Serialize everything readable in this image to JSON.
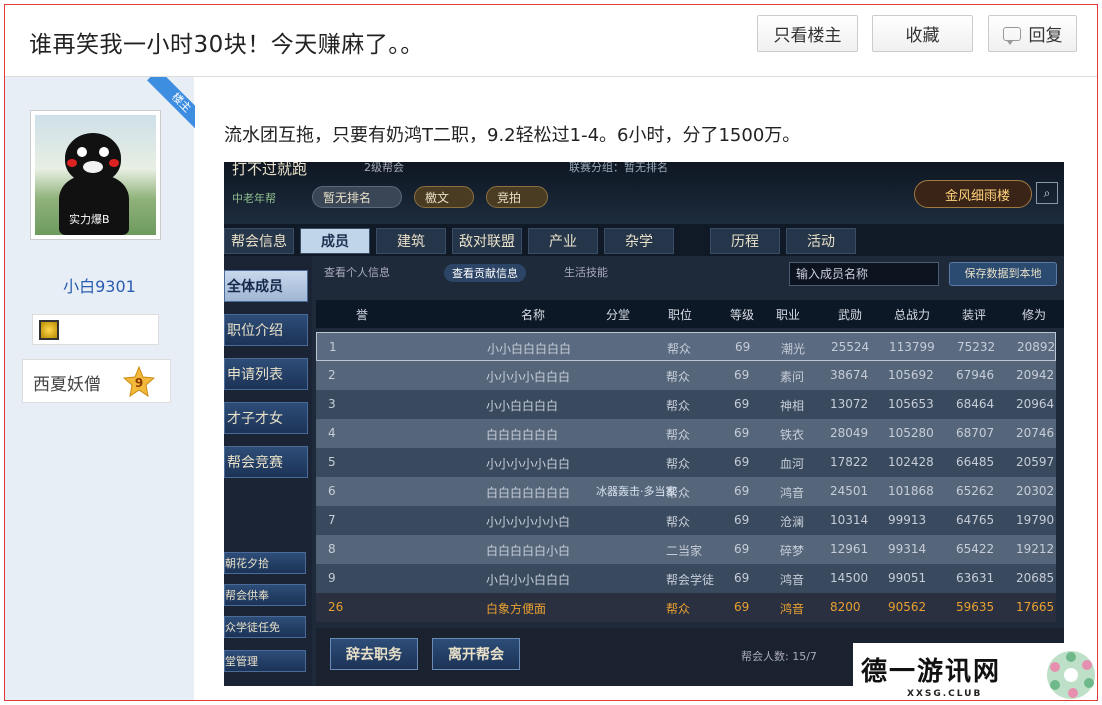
{
  "header": {
    "title": "谁再笑我一小时30块！今天赚麻了。。",
    "btn_owner_only": "只看楼主",
    "btn_favorite": "收藏",
    "btn_reply": "回复"
  },
  "author": {
    "badge": "楼主",
    "avatar_caption": "实力爆B",
    "username": "小白9301",
    "rank_title": "西夏妖僧",
    "rank_level": "9"
  },
  "post": {
    "text": "流水团互拖，只要有奶鸿T二职，9.2轻松过1-4。6小时，分了1500万。"
  },
  "game": {
    "top_title": "打不过就跑",
    "top_sub": "2级帮会",
    "top_note": "联赛分组：暂无排名",
    "top_left": "中老年帮",
    "pill_rank": "暂无排名",
    "pill_edict": "檄文",
    "pill_auction": "竞拍",
    "guild_name": "金风细雨楼",
    "tabs": [
      "帮会信息",
      "成员",
      "建筑",
      "敌对联盟",
      "产业",
      "杂学",
      "历程",
      "活动"
    ],
    "left_menu": [
      "全体成员",
      "职位介绍",
      "申请列表",
      "才子才女",
      "帮会竞赛"
    ],
    "left_small": [
      "朝花夕拾",
      "帮会供奉",
      "众学徒任免",
      "堂管理"
    ],
    "filters": [
      "查看个人信息",
      "查看贡献信息",
      "生活技能"
    ],
    "search_placeholder": "输入成员名称",
    "save_btn": "保存数据到本地",
    "columns": [
      "誉",
      "名称",
      "分堂",
      "职位",
      "等级",
      "职业",
      "武勋",
      "总战力",
      "装评",
      "修为"
    ],
    "rows": [
      [
        "1",
        "小小白白白白白",
        "",
        "帮众",
        "69",
        "潮光",
        "25524",
        "113799",
        "75232",
        "20892"
      ],
      [
        "2",
        "小小小小白白白",
        "",
        "帮众",
        "69",
        "素问",
        "38674",
        "105692",
        "67946",
        "20942"
      ],
      [
        "3",
        "小小白白白白",
        "",
        "帮众",
        "69",
        "神相",
        "13072",
        "105653",
        "68464",
        "20964"
      ],
      [
        "4",
        "白白白白白白",
        "",
        "帮众",
        "69",
        "铁衣",
        "28049",
        "105280",
        "68707",
        "20746"
      ],
      [
        "5",
        "小小小小小白白",
        "",
        "帮众",
        "69",
        "血河",
        "17822",
        "102428",
        "66485",
        "20597"
      ],
      [
        "6",
        "白白白白白白白",
        "",
        "帮众",
        "69",
        "鸿音",
        "24501",
        "101868",
        "65262",
        "20302"
      ],
      [
        "7",
        "小小小小小小白",
        "",
        "帮众",
        "69",
        "沧澜",
        "10314",
        "99913",
        "64765",
        "19790"
      ],
      [
        "8",
        "白白白白白小白",
        "",
        "二当家",
        "69",
        "碎梦",
        "12961",
        "99314",
        "65422",
        "19212"
      ],
      [
        "9",
        "小白小小白白白",
        "",
        "帮会学徒",
        "69",
        "鸿音",
        "14500",
        "99051",
        "63631",
        "20685"
      ],
      [
        "26",
        "白象方便面",
        "",
        "帮众",
        "69",
        "鸿音",
        "8200",
        "90562",
        "59635",
        "17665"
      ]
    ],
    "toast": "冰器轰击·多当家",
    "btn_resign": "辞去职务",
    "btn_leave": "离开帮会",
    "member_count": "帮会人数: 15/7"
  },
  "watermark": {
    "title": "德一游讯网",
    "url": "XXSG.CLUB"
  }
}
